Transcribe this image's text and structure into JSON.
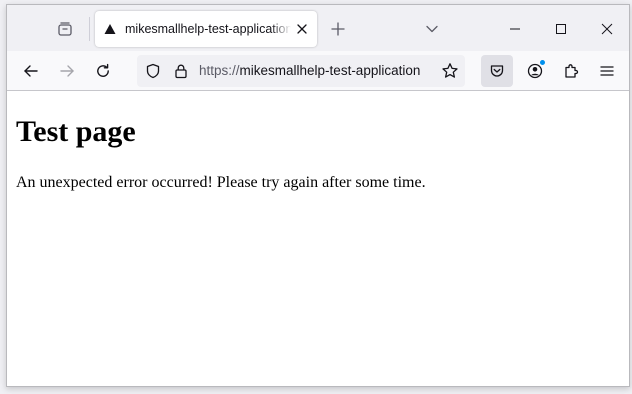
{
  "browser": {
    "tab": {
      "title": "mikesmallhelp-test-application"
    },
    "urlbar": {
      "scheme": "https://",
      "host": "mikesmallhelp-test-application"
    },
    "colors": {
      "chrome": "#f0f0f4",
      "toolbar": "#f9f9fb",
      "accent": "#0090ed"
    }
  },
  "page": {
    "heading": "Test page",
    "message": "An unexpected error occurred! Please try again after some time."
  }
}
